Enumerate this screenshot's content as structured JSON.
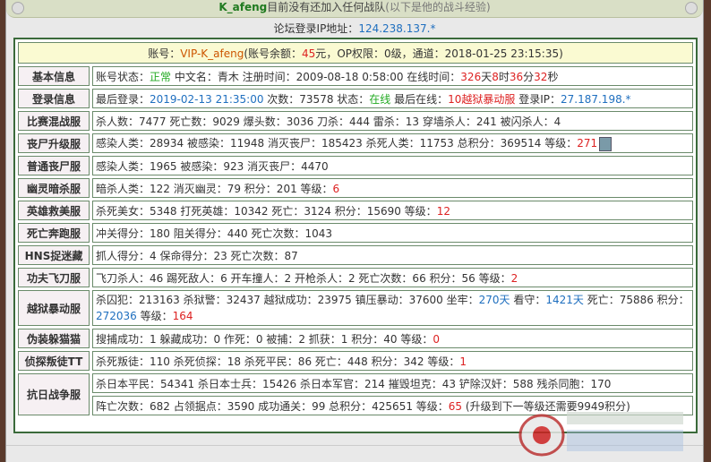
{
  "header": {
    "username": "K_afeng",
    "no_team": "目前没有还加入任何战队",
    "sub_note": "(以下是他的战斗经验)",
    "ip_label": "论坛登录IP地址：",
    "ip_value": "124.238.137.*"
  },
  "account": {
    "prefix": "账号：",
    "vip": "VIP-K_afeng",
    "balance_label": "(账号余额：",
    "balance": "45",
    "balance_unit": "元",
    "op_label": "，OP权限：0级，通道：",
    "date": "2018-01-25 23:15:35",
    "suffix": ")"
  },
  "rows": [
    {
      "label": "基本信息",
      "parts": [
        {
          "t": "账号状态："
        },
        {
          "t": "正常",
          "c": "g"
        },
        {
          "t": " 中文名：青木 注册时间：2009-08-18 0:58:00 在线时间："
        },
        {
          "t": "326",
          "c": "r"
        },
        {
          "t": "天"
        },
        {
          "t": "8",
          "c": "r"
        },
        {
          "t": "时"
        },
        {
          "t": "36",
          "c": "r"
        },
        {
          "t": "分"
        },
        {
          "t": "32",
          "c": "r"
        },
        {
          "t": "秒"
        }
      ]
    },
    {
      "label": "登录信息",
      "parts": [
        {
          "t": "最后登录："
        },
        {
          "t": "2019-02-13 21:35:00",
          "c": "v"
        },
        {
          "t": " 次数：73578 状态："
        },
        {
          "t": "在线",
          "c": "g"
        },
        {
          "t": " 最后在线："
        },
        {
          "t": "10越狱暴动服",
          "c": "r"
        },
        {
          "t": " 登录IP："
        },
        {
          "t": "27.187.198.*",
          "c": "v"
        }
      ]
    },
    {
      "label": "比赛混战服",
      "parts": [
        {
          "t": "杀人数：7477 死亡数：9029 爆头数：3036 刀杀：444 雷杀：13 穿墙杀人：241 被闪杀人：4"
        }
      ]
    },
    {
      "label": "丧尸升级服",
      "avatar": true,
      "parts": [
        {
          "t": "感染人类：28934 被感染：11948 消灭丧尸：185423 杀死人类：11753 总积分：369514 等级："
        },
        {
          "t": "271",
          "c": "r"
        }
      ]
    },
    {
      "label": "普通丧尸服",
      "parts": [
        {
          "t": "感染人类：1965 被感染：923 消灭丧尸：4470"
        }
      ]
    },
    {
      "label": "幽灵暗杀服",
      "parts": [
        {
          "t": "暗杀人类：122 消灭幽灵：79 积分：201 等级："
        },
        {
          "t": "6",
          "c": "r"
        }
      ]
    },
    {
      "label": "英雄救美服",
      "parts": [
        {
          "t": "杀死美女：5348 打死英雄：10342 死亡：3124 积分：15690 等级："
        },
        {
          "t": "12",
          "c": "r"
        }
      ]
    },
    {
      "label": "死亡奔跑服",
      "parts": [
        {
          "t": "冲关得分：180 阻关得分：440 死亡次数：1043"
        }
      ]
    },
    {
      "label": "HNS捉迷藏",
      "parts": [
        {
          "t": "抓人得分：4 保命得分：23 死亡次数：87"
        }
      ]
    },
    {
      "label": "功夫飞刀服",
      "parts": [
        {
          "t": "飞刀杀人：46 踢死敌人：6 开车撞人：2 开枪杀人：2 死亡次数：66 积分：56 等级："
        },
        {
          "t": "2",
          "c": "r"
        }
      ]
    },
    {
      "label": "越狱暴动服",
      "tall": true,
      "parts": [
        {
          "t": "杀囚犯：213163 杀狱警：32437 越狱成功：23975 镇压暴动：37600 坐牢："
        },
        {
          "t": "270天",
          "c": "v"
        },
        {
          "t": " 看守："
        },
        {
          "t": "1421天",
          "c": "v"
        },
        {
          "t": " 死亡：75886 积分："
        },
        {
          "br": true
        },
        {
          "t": "272036",
          "c": "v"
        },
        {
          "t": " 等级："
        },
        {
          "t": "164",
          "c": "r"
        }
      ]
    },
    {
      "label": "伪装躲猫猫",
      "parts": [
        {
          "t": "搜捕成功：1 躲藏成功：0 作死：0 被捕：2 抓获：1 积分：40 等级："
        },
        {
          "t": "0",
          "c": "r"
        }
      ]
    },
    {
      "label": "侦探叛徒TT",
      "parts": [
        {
          "t": "杀死叛徒：110 杀死侦探：18 杀死平民：86 死亡：448 积分：342 等级："
        },
        {
          "t": "1",
          "c": "r"
        }
      ]
    }
  ],
  "kangri": {
    "label": "抗日战争服",
    "line1": "杀日本平民：54341 杀日本士兵：15426 杀日本军官：214 摧毁坦克：43 铲除汉奸：588 残杀同胞：170",
    "line2_a": "阵亡次数：682 占领据点：3590 成功通关：99 总积分：425651 等级：",
    "line2_level": "65",
    "line2_b": " (升级到下一等级还需要9949积分)"
  },
  "colors": {
    "label": "#8a1c46",
    "green": "#22aa22",
    "red": "#dd2222",
    "blue": "#1f6fbf",
    "frame": "#3a6a3a"
  }
}
